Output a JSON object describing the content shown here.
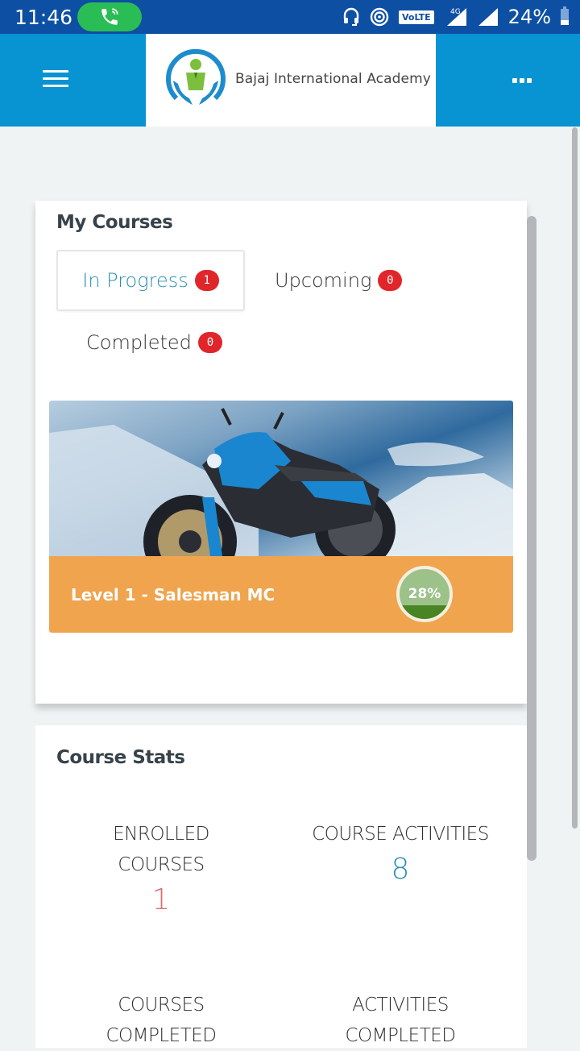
{
  "status_bar": {
    "time": "11:46",
    "volte": "VoLTE",
    "network": "4G",
    "battery_percent": "24%",
    "colors": {
      "background": "#0d4fa3",
      "call_pill": "#2bbd55"
    }
  },
  "app_bar": {
    "brand": "Bajaj International Academy",
    "menu_icon": "hamburger-icon",
    "more_icon": "more-horizontal-icon",
    "colors": {
      "background": "#0893d3"
    }
  },
  "my_courses": {
    "title": "My Courses",
    "tabs": [
      {
        "label": "In Progress",
        "count": "1",
        "active": true
      },
      {
        "label": "Upcoming",
        "count": "0",
        "active": false
      },
      {
        "label": "Completed",
        "count": "0",
        "active": false
      }
    ],
    "courses": [
      {
        "name": "Level 1 - Salesman MC",
        "progress_percent": 28,
        "progress_label": "28%"
      }
    ],
    "colors": {
      "tile_footer": "#f0a44e",
      "badge": "#e0262b",
      "active_tab_text": "#2a8fb3"
    }
  },
  "course_stats": {
    "title": "Course Stats",
    "items": [
      {
        "label_line1": "ENROLLED",
        "label_line2": "COURSES",
        "value": "1",
        "color": "#e06b6b"
      },
      {
        "label_line1": "COURSE ACTIVITIES",
        "label_line2": "",
        "value": "8",
        "color": "#2a8fb3"
      },
      {
        "label_line1": "COURSES",
        "label_line2": "COMPLETED",
        "value": "",
        "color": "#2d2d2d"
      },
      {
        "label_line1": "ACTIVITIES",
        "label_line2": "COMPLETED",
        "value": "",
        "color": "#2d2d2d"
      }
    ]
  }
}
